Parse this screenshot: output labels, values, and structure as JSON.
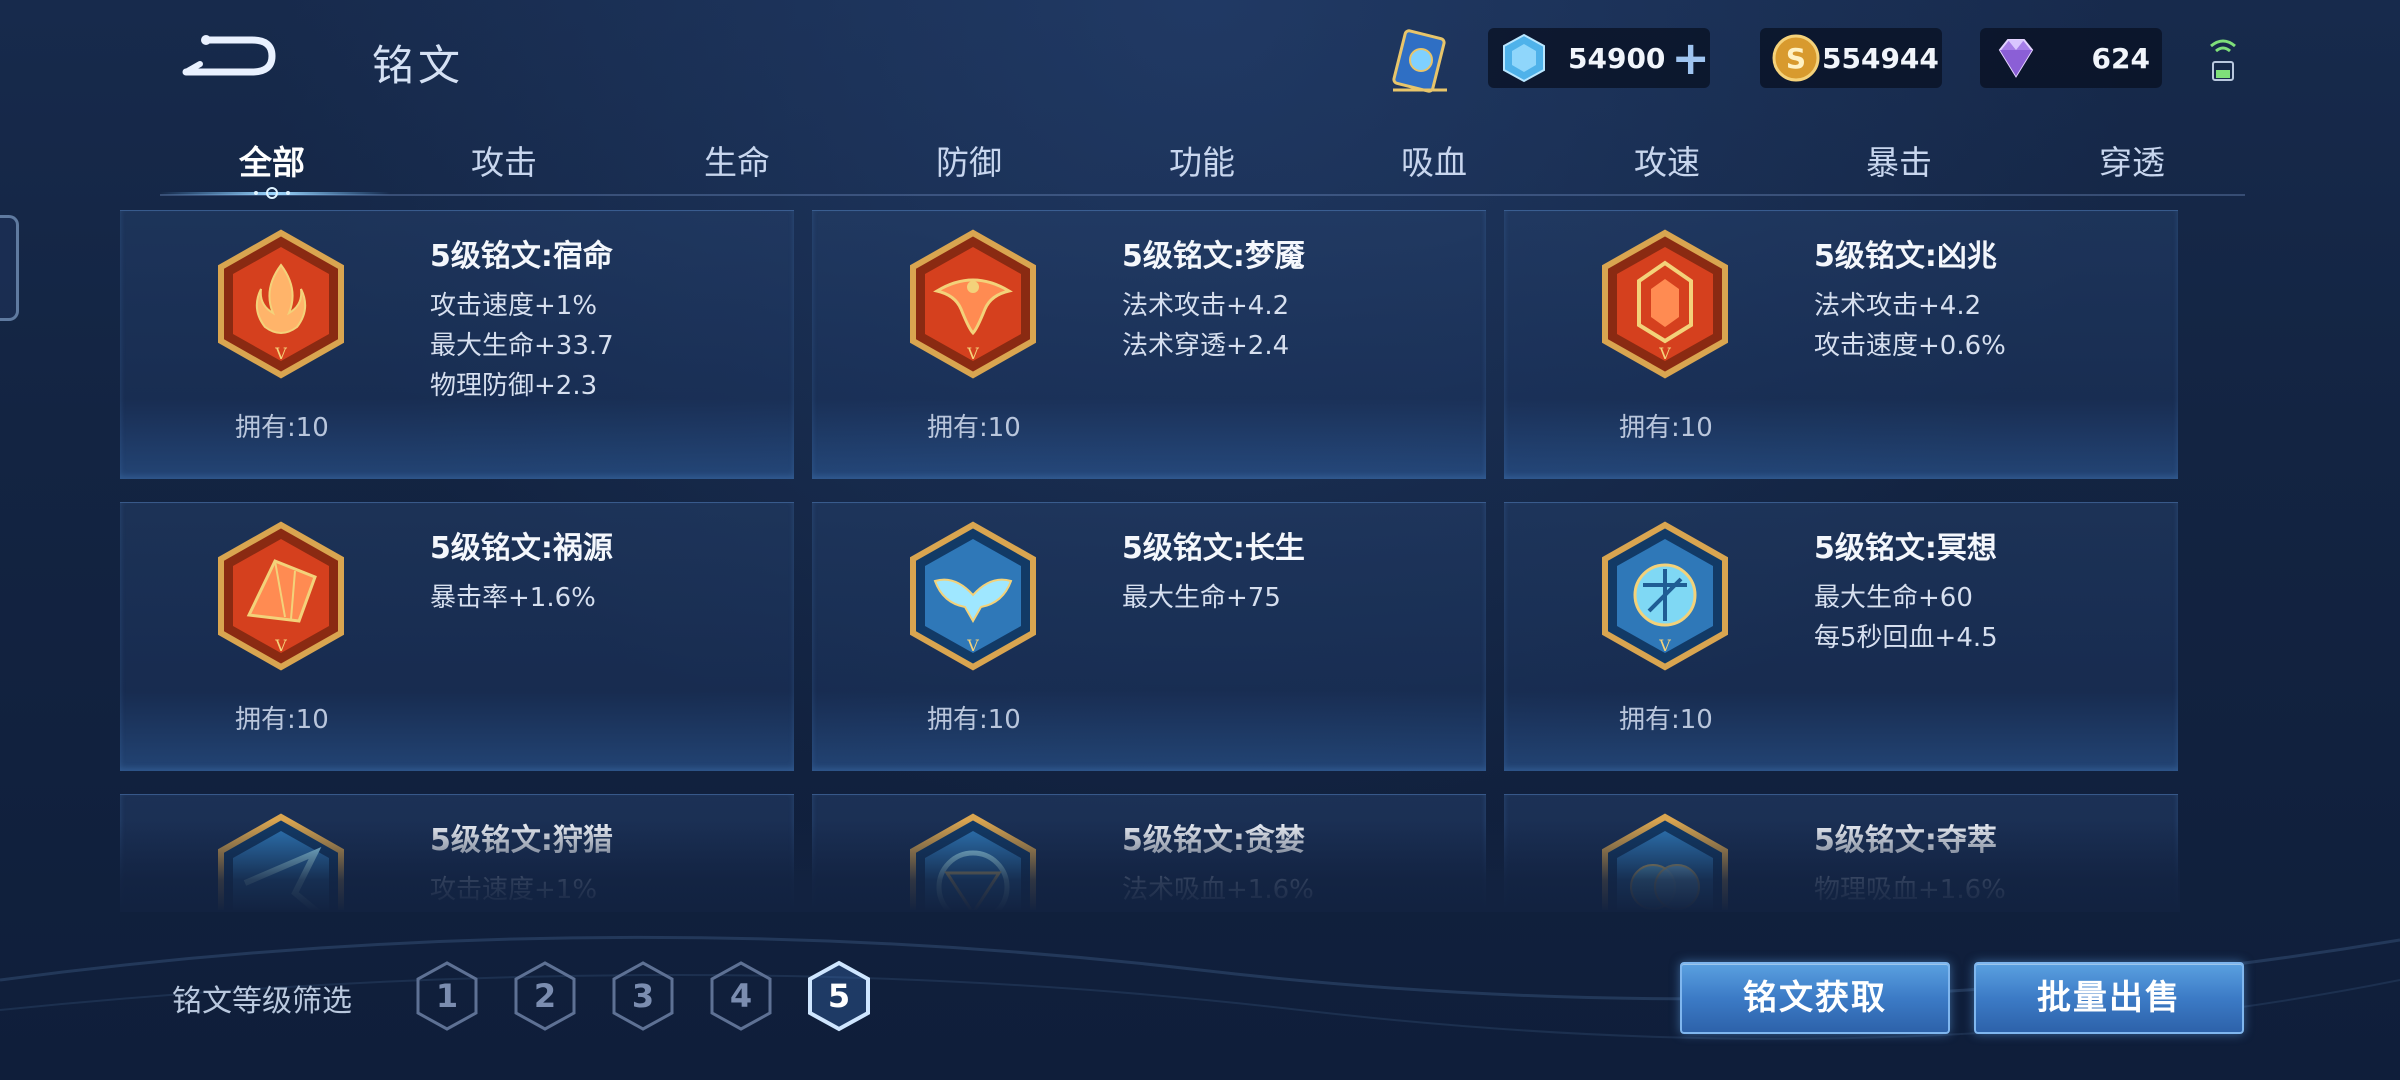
{
  "header": {
    "title": "铭文",
    "currencies": {
      "coupon": "54900",
      "gold": "554944",
      "gem": "624"
    }
  },
  "tabs": [
    "全部",
    "攻击",
    "生命",
    "防御",
    "功能",
    "吸血",
    "攻速",
    "暴击",
    "穿透"
  ],
  "active_tab": "全部",
  "inscriptions": [
    {
      "name": "5级铭文:宿命",
      "stats": [
        "攻击速度+1%",
        "最大生命+33.7",
        "物理防御+2.3"
      ],
      "owned": "拥有:10",
      "color": "red"
    },
    {
      "name": "5级铭文:梦魇",
      "stats": [
        "法术攻击+4.2",
        "法术穿透+2.4"
      ],
      "owned": "拥有:10",
      "color": "red"
    },
    {
      "name": "5级铭文:凶兆",
      "stats": [
        "法术攻击+4.2",
        "攻击速度+0.6%"
      ],
      "owned": "拥有:10",
      "color": "red"
    },
    {
      "name": "5级铭文:祸源",
      "stats": [
        "暴击率+1.6%"
      ],
      "owned": "拥有:10",
      "color": "red"
    },
    {
      "name": "5级铭文:长生",
      "stats": [
        "最大生命+75"
      ],
      "owned": "拥有:10",
      "color": "blue"
    },
    {
      "name": "5级铭文:冥想",
      "stats": [
        "最大生命+60",
        "每5秒回血+4.5"
      ],
      "owned": "拥有:10",
      "color": "blue"
    },
    {
      "name": "5级铭文:狩猎",
      "stats": [
        "攻击速度+1%"
      ],
      "owned": "",
      "color": "blue"
    },
    {
      "name": "5级铭文:贪婪",
      "stats": [
        "法术吸血+1.6%"
      ],
      "owned": "",
      "color": "blue"
    },
    {
      "name": "5级铭文:夺萃",
      "stats": [
        "物理吸血+1.6%"
      ],
      "owned": "",
      "color": "blue"
    }
  ],
  "footer": {
    "filter_label": "铭文等级筛选",
    "levels": [
      "1",
      "2",
      "3",
      "4",
      "5"
    ],
    "active_level": "5",
    "get_button": "铭文获取",
    "sell_button": "批量出售"
  },
  "colors": {
    "accent_blue": "#3c7bc6",
    "red_emblem": "#d5401e",
    "blue_emblem": "#2f78b8",
    "gold_frame": "#d9a550"
  }
}
